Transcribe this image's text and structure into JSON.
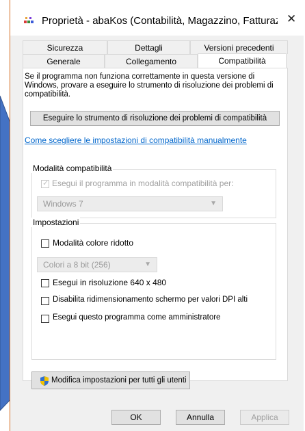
{
  "window": {
    "title": "Proprietà - abaKos (Contabilità, Magazzino, Fatturazion...",
    "close_glyph": "✕"
  },
  "tabs_row1": [
    {
      "label": "Sicurezza"
    },
    {
      "label": "Dettagli"
    },
    {
      "label": "Versioni precedenti"
    }
  ],
  "tabs_row2": [
    {
      "label": "Generale"
    },
    {
      "label": "Collegamento"
    },
    {
      "label": "Compatibilità",
      "active": true
    }
  ],
  "compat": {
    "intro": "Se il programma non funziona correttamente in questa versione di Windows, provare a eseguire lo strumento di risoluzione dei problemi di compatibilità.",
    "troubleshooter_button": "Eseguire lo strumento di risoluzione dei problemi di compatibilità",
    "manual_link": "Come scegliere le impostazioni di compatibilità manualmente",
    "mode_group": {
      "label": "Modalità compatibilità",
      "checkbox_label": "Esegui il programma in modalità compatibilità per:",
      "checked": true,
      "os_value": "Windows 7"
    },
    "settings_group": {
      "label": "Impostazioni",
      "reduced_color": "Modalità colore ridotto",
      "color_value": "Colori a 8 bit (256)",
      "resolution": "Esegui in risoluzione 640 x 480",
      "dpi": "Disabilita ridimensionamento schermo per valori DPI alti",
      "admin": "Esegui questo programma come amministratore"
    },
    "all_users_button": "Modifica impostazioni per tutti gli utenti"
  },
  "footer": {
    "ok": "OK",
    "cancel": "Annulla",
    "apply": "Applica"
  },
  "colors": {
    "accent_arrow": "#4472c4",
    "link": "#0066cc",
    "window_border": "#d46a1e"
  },
  "icons": {
    "title": "properties-icon",
    "shield": "uac-shield-icon"
  }
}
